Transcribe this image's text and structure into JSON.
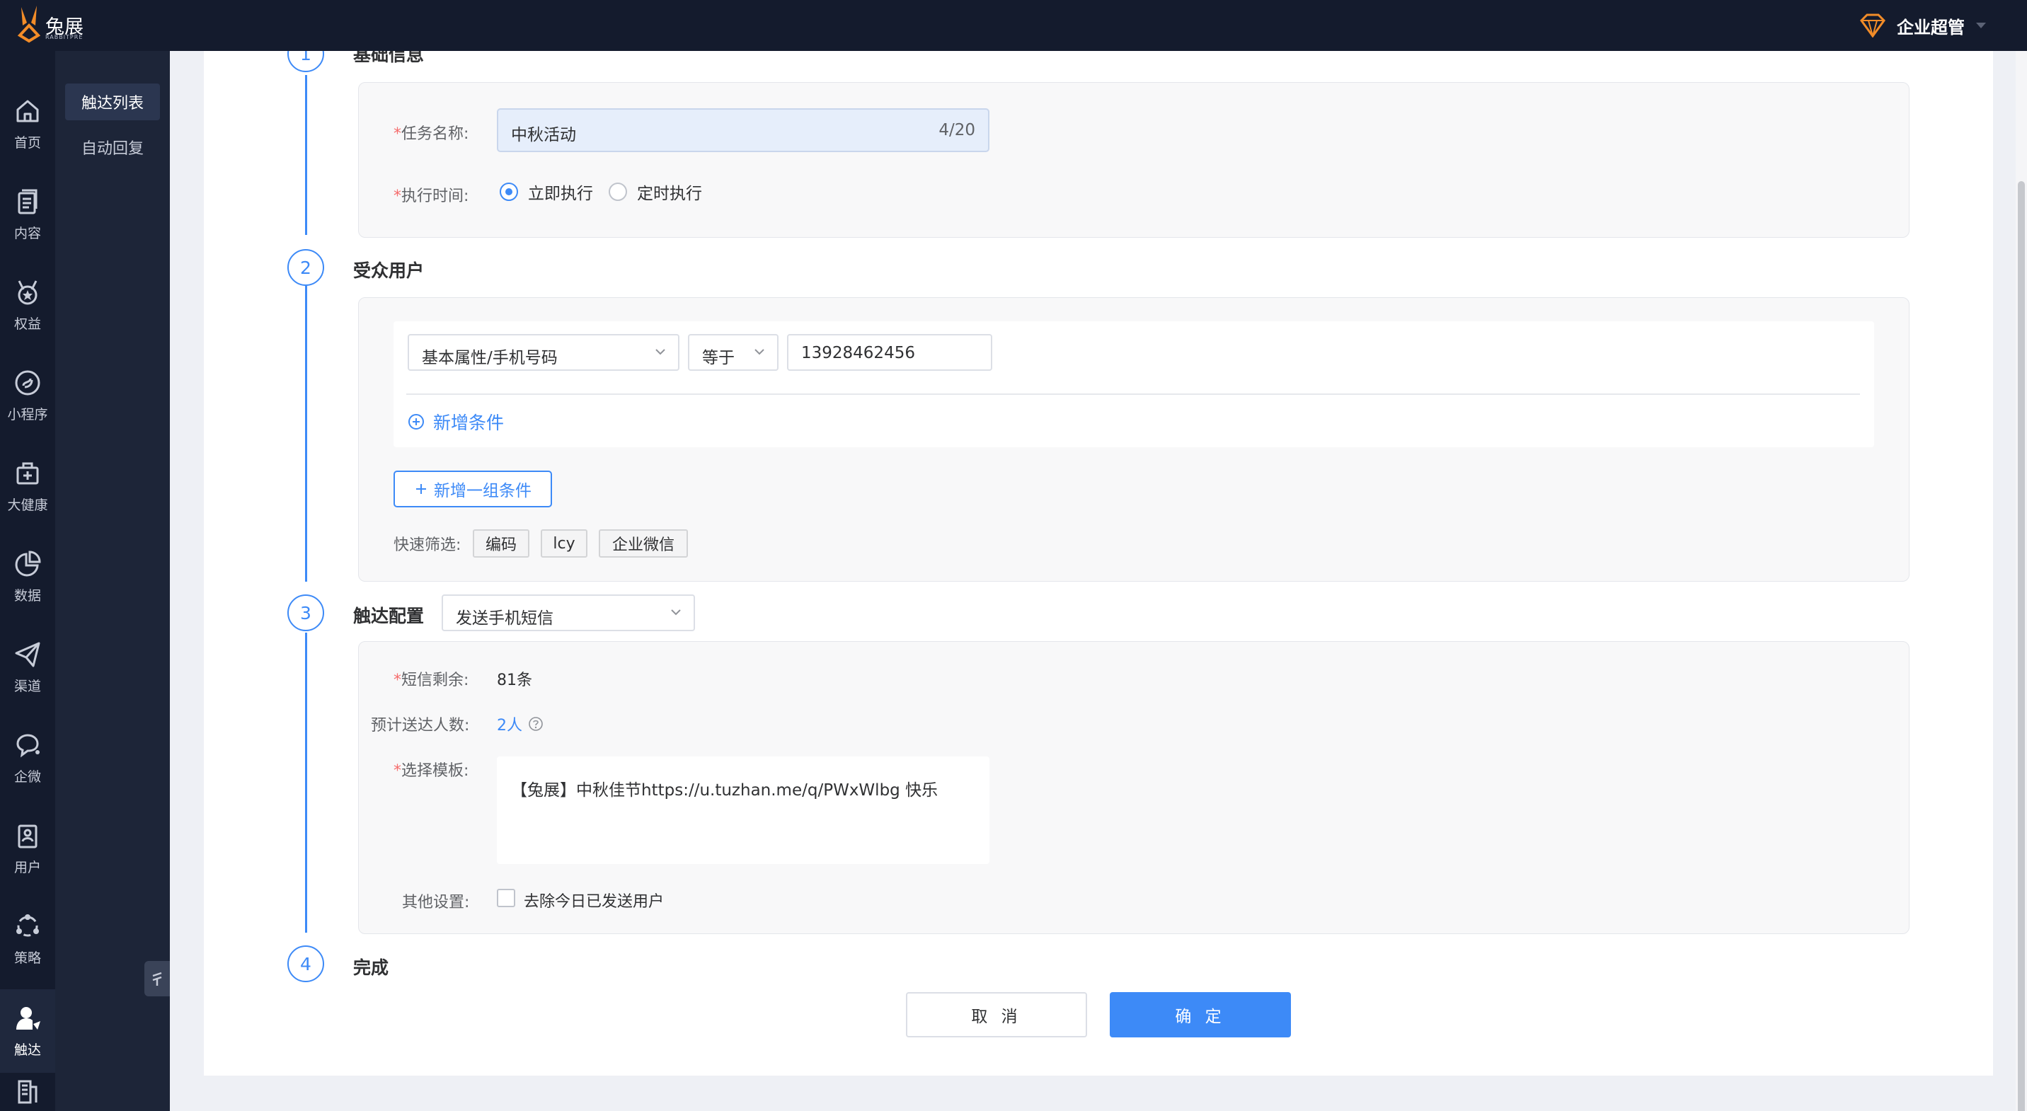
{
  "app": {
    "logo_text": "兔展",
    "logo_sub": "RABBITPRE",
    "brand_color": "#f28c28",
    "user_name": "企业超管"
  },
  "rail": [
    {
      "label": "首页",
      "icon": "home-icon"
    },
    {
      "label": "内容",
      "icon": "document-icon"
    },
    {
      "label": "权益",
      "icon": "medal-icon"
    },
    {
      "label": "小程序",
      "icon": "mini-program-icon"
    },
    {
      "label": "大健康",
      "icon": "medical-kit-icon"
    },
    {
      "label": "数据",
      "icon": "pie-chart-icon"
    },
    {
      "label": "渠道",
      "icon": "paper-plane-icon"
    },
    {
      "label": "企微",
      "icon": "chat-bubble-icon"
    },
    {
      "label": "用户",
      "icon": "user-card-icon"
    },
    {
      "label": "策略",
      "icon": "strategy-icon"
    },
    {
      "label": "触达",
      "icon": "user-reach-icon"
    }
  ],
  "subnav": [
    {
      "label": "触达列表"
    },
    {
      "label": "自动回复"
    }
  ],
  "steps": [
    {
      "num": "1",
      "title": "基础信息"
    },
    {
      "num": "2",
      "title": "受众用户"
    },
    {
      "num": "3",
      "title": "触达配置"
    },
    {
      "num": "4",
      "title": "完成"
    }
  ],
  "basic": {
    "task_label": "任务名称:",
    "task_value": "中秋活动",
    "task_count": "4/20",
    "time_label": "执行时间:",
    "radio_now": "立即执行",
    "radio_scheduled": "定时执行",
    "selected": "立即执行"
  },
  "audience": {
    "attr_select": "基本属性/手机号码",
    "op_select": "等于",
    "value": "13928462456",
    "add_condition": "新增条件",
    "add_group": "新增一组条件",
    "quick_label": "快速筛选:",
    "tags": [
      "编码",
      "lcy",
      "企业微信"
    ]
  },
  "reach": {
    "channel_select": "发送手机短信",
    "sms_label": "短信剩余:",
    "sms_value": "81条",
    "est_label": "预计送达人数:",
    "est_value": "2人",
    "template_label": "选择模板:",
    "template_text": "【兔展】中秋佳节https://u.tuzhan.me/q/PWxWlbg 快乐",
    "other_label": "其他设置:",
    "exclude_label": "去除今日已发送用户"
  },
  "footer": {
    "cancel": "取 消",
    "ok": "确 定"
  },
  "colors": {
    "primary": "#3d8af7",
    "required": "#f56c6c",
    "topbar": "#141b2d"
  }
}
